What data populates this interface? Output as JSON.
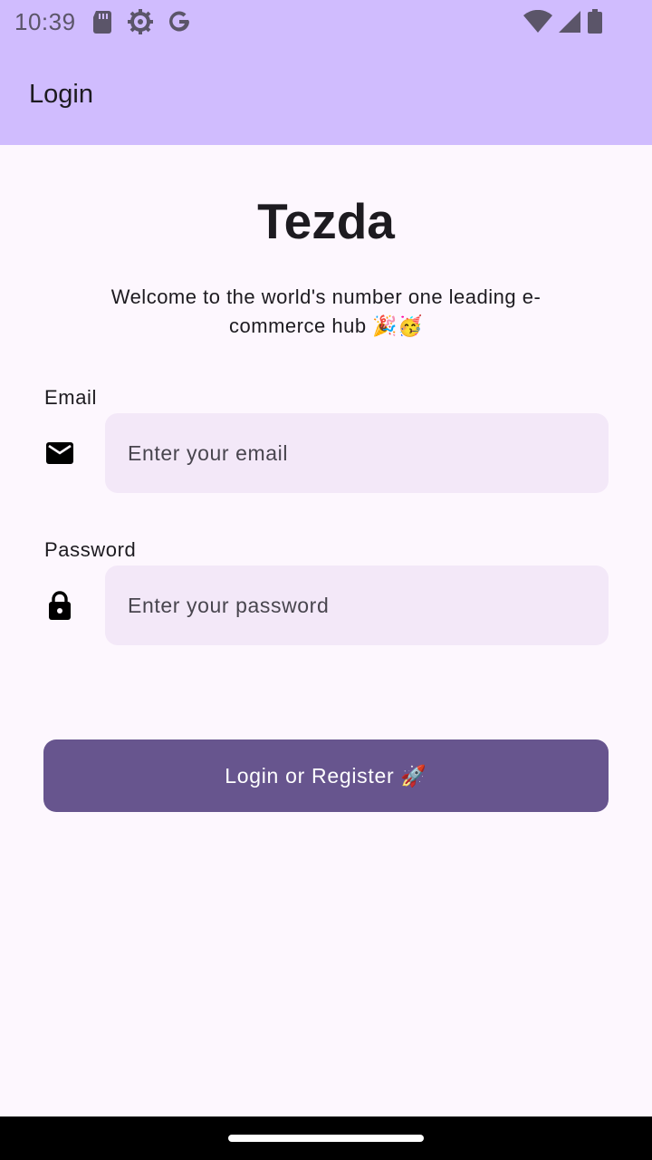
{
  "status_bar": {
    "time": "10:39",
    "left_icons": [
      "sd-card-icon",
      "settings-gear-icon",
      "google-icon"
    ],
    "right_icons": [
      "wifi-icon",
      "cell-signal-icon",
      "battery-icon"
    ]
  },
  "app_bar": {
    "title": "Login"
  },
  "brand": {
    "title": "Tezda",
    "tagline": "Welcome to the world's number one leading e-commerce hub 🎉🥳"
  },
  "form": {
    "email": {
      "label": "Email",
      "placeholder": "Enter your email",
      "icon": "mail-icon"
    },
    "password": {
      "label": "Password",
      "placeholder": "Enter your password",
      "icon": "lock-icon"
    },
    "submit_label": "Login or Register 🚀"
  },
  "colors": {
    "app_bar": "#d0bcfe",
    "background": "#fdf7fe",
    "input_fill": "#f3e8f8",
    "button": "#67558e"
  }
}
